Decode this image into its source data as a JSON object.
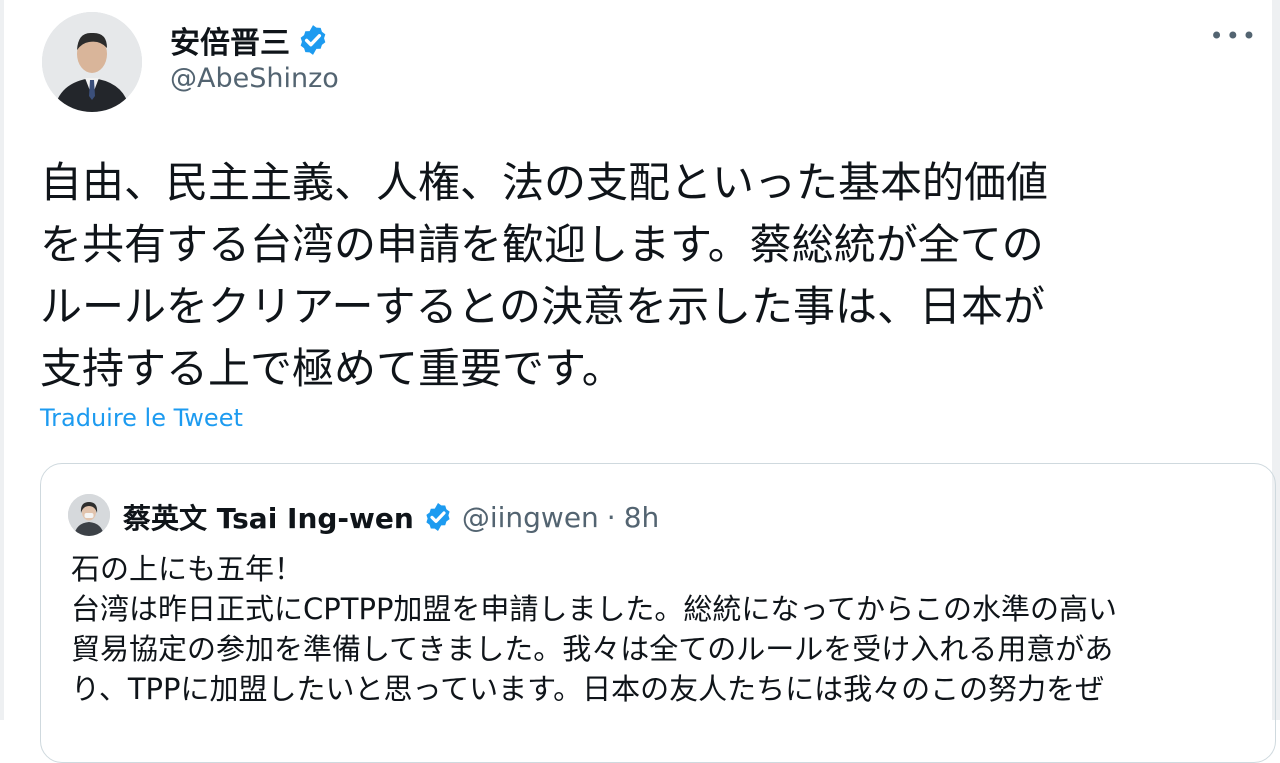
{
  "tweet": {
    "author": {
      "display_name": "安倍晋三",
      "handle": "@AbeShinzo",
      "verified_icon": "verified-badge-icon",
      "avatar_icon": "profile-photo"
    },
    "more_icon": "ellipsis-icon",
    "more_label": "•••",
    "text": "自由、民主主義、人権、法の支配といった基本的価値\nを共有する台湾の申請を歓迎します。蔡総統が全ての\nルールをクリアーするとの決意を示した事は、日本が\n支持する上で極めて重要です。",
    "translate_label": "Traduire le Tweet"
  },
  "quoted": {
    "display_name": "蔡英文 Tsai Ing-wen",
    "handle": "@iingwen",
    "separator": "·",
    "time": "8h",
    "text": "石の上にも五年！\n台湾は昨日正式にCPTPP加盟を申請しました。総統になってからこの水準の高い\n貿易協定の参加を準備してきました。我々は全てのルールを受け入れる用意があ\nり、TPPに加盟したいと思っています。日本の友人たちには我々のこの努力をぜ"
  },
  "colors": {
    "accent": "#1d9bf0",
    "text_primary": "#0f1419",
    "text_secondary": "#536471",
    "border": "#cfd9de"
  }
}
